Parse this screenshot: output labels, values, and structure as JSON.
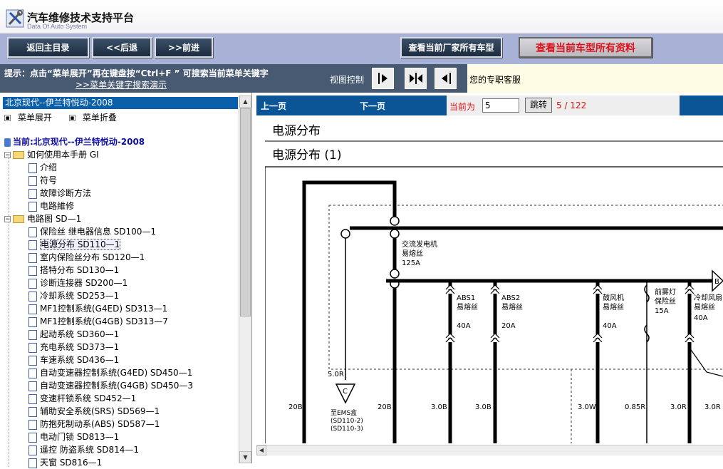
{
  "app": {
    "title": "汽车维修技术支持平台",
    "subtitle": "Data Of Auto System"
  },
  "toolbar": {
    "home": "返回主目录",
    "back": "<<后退",
    "forward": ">>前进",
    "all_models": "查看当前厂家所有车型",
    "all_docs": "查看当前车型所有资料"
  },
  "hint": {
    "text": "提示：点击“菜单展开”再在键盘按“Ctrl+F ” 可搜索当前菜单关键字",
    "link": ">>菜单关键字搜索演示",
    "view_label": "视图控制",
    "service": "您的专职客服"
  },
  "tree": {
    "breadcrumb": "北京现代--伊兰特悦动-2008",
    "expand": "菜单展开",
    "collapse": "菜单折叠",
    "current": "当前:北京现代--伊兰特悦动-2008",
    "sections": [
      {
        "label": "如何使用本手册  GI",
        "items": [
          "介绍",
          "符号",
          "故障诊断方法",
          "电路維修"
        ]
      },
      {
        "label": "电路图  SD—1",
        "items": [
          "保险丝 继电器信息  SD100—1",
          "电源分布  SD110—1",
          "室内保险丝分布  SD120—1",
          "搭特分布  SD130—1",
          "诊断连接器  SD200—1",
          "冷却系统  SD253—1",
          "MF1控制系统(G4ED)  SD313—1",
          "MF1控制系统(G4GB)  SD313—7",
          "起动系统  SD360—1",
          "充电系统  SD373—1",
          "车速系统  SD436—1",
          "自动变速器控制系统(G4ED)  SD450—1",
          "自动变速器控制系统(G4GB)  SD450—3",
          "变速杆锁系统  SD452—1",
          "辅助安全系统(SRS)  SD569—1",
          "防抱死制动系(ABS) SD587—1",
          "电动门锁  SD813—1",
          "遥控 防盗系统  SD814—1",
          "天窗  SD816—1"
        ]
      }
    ]
  },
  "viewer": {
    "prev": "上一页",
    "next": "下一页",
    "current_label": "当前为",
    "page_value": "5",
    "jump": "跳转",
    "page_count": "5 / 122"
  },
  "document": {
    "heading": "电源分布",
    "subheading": "电源分布  (1)",
    "alt_fuse": [
      "交流发电机",
      "易熔丝",
      "125A"
    ],
    "fuses": [
      {
        "name": "ABS1",
        "type": "易熔丝",
        "amp": "40A"
      },
      {
        "name": "ABS2",
        "type": "易熔丝",
        "amp": "20A"
      },
      {
        "name": "鼓风机",
        "type": "易熔丝",
        "amp": "40A"
      },
      {
        "name": "前雾灯",
        "type": "保险丝",
        "amp": "15A"
      },
      {
        "name": "冷却风扇",
        "type": "易熔丝",
        "amp": "40A"
      }
    ],
    "connector_c": "C",
    "connector_b": "B",
    "wire_50r": "5.0R",
    "ems_label": [
      "至EMS盒",
      "(SD110-2)",
      "(SD110-3)"
    ],
    "wires": [
      "20B",
      "20B",
      "3.0B",
      "3.0B",
      "3.0W",
      "0.85R",
      "3.0R",
      "3.0R"
    ]
  }
}
